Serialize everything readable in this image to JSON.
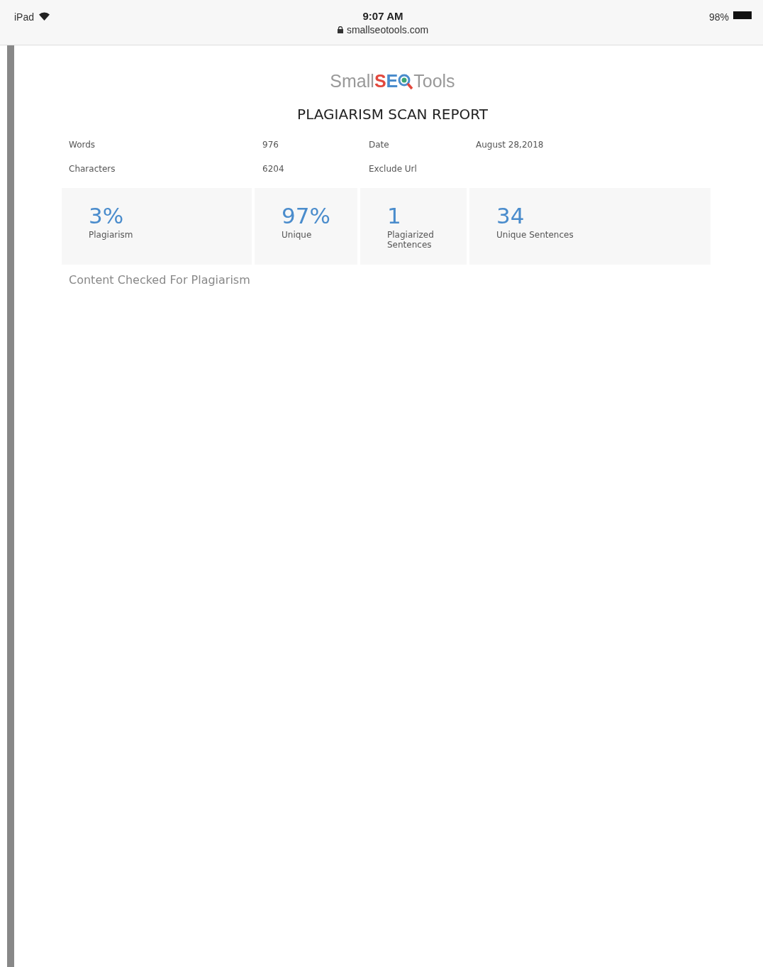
{
  "status_bar": {
    "device": "iPad",
    "time": "9:07 AM",
    "url": "smallseotools.com",
    "battery": "98%"
  },
  "logo": {
    "before": "Small",
    "mark_1": "S",
    "mark_2": "E",
    "after": "Tools"
  },
  "title": "PLAGIARISM SCAN REPORT",
  "details": [
    {
      "label": "Words",
      "value": "976"
    },
    {
      "label": "Date",
      "value": "August 28,2018"
    },
    {
      "label": "Characters",
      "value": "6204"
    },
    {
      "label": "Exclude Url"
    }
  ],
  "stats": [
    {
      "value": "3%",
      "label": "Plagiarism"
    },
    {
      "value": "97%",
      "label": "Unique"
    },
    {
      "value": "1",
      "label": "Plagiarized Sentences"
    },
    {
      "value": "34",
      "label": "Unique Sentences"
    }
  ],
  "section_heading": "Content Checked For Plagiarism"
}
